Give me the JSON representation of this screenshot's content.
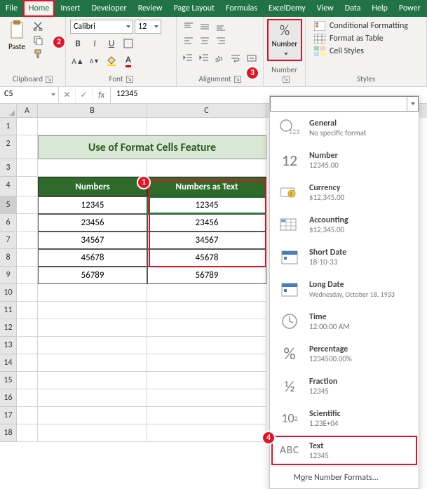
{
  "tabs": {
    "file": "File",
    "home": "Home",
    "insert": "Insert",
    "developer": "Developer",
    "review": "Review",
    "page_layout": "Page Layout",
    "formulas": "Formulas",
    "exceldemy": "ExcelDemy",
    "view": "View",
    "data": "Data",
    "help": "Help",
    "power": "Power"
  },
  "ribbon": {
    "clipboard": {
      "label": "Clipboard",
      "paste": "Paste"
    },
    "font": {
      "label": "Font",
      "name": "Calibri",
      "size": "12"
    },
    "alignment": {
      "label": "Alignment"
    },
    "number": {
      "label": "Number",
      "btn": "Number"
    },
    "styles": {
      "label": "Styles",
      "cond": "Conditional Formatting",
      "table": "Format as Table",
      "cell": "Cell Styles"
    }
  },
  "callouts": {
    "c1": "1",
    "c2": "2",
    "c3": "3",
    "c4": "4"
  },
  "fx": {
    "namebox": "C5",
    "fx": "fx",
    "value": "12345"
  },
  "cols": {
    "A": "A",
    "B": "B",
    "C": "C"
  },
  "rowhdrs": [
    "1",
    "2",
    "3",
    "4",
    "5",
    "6",
    "7",
    "8",
    "9",
    "10",
    "11",
    "12",
    "13",
    "14",
    "15",
    "16",
    "17",
    "18"
  ],
  "sheet": {
    "title": "Use of Format Cells Feature",
    "h1": "Numbers",
    "h2": "Numbers as Text",
    "rows": [
      {
        "b": "12345",
        "c": "12345"
      },
      {
        "b": "23456",
        "c": "23456"
      },
      {
        "b": "34567",
        "c": "34567"
      },
      {
        "b": "45678",
        "c": "45678"
      },
      {
        "b": "56789",
        "c": "56789"
      }
    ]
  },
  "nf": {
    "general": {
      "t": "General",
      "s": "No specific format",
      "i": "123"
    },
    "number": {
      "t": "Number",
      "s": "12345.00",
      "i": "12"
    },
    "currency": {
      "t": "Currency",
      "s": "$12,345.00"
    },
    "accounting": {
      "t": "Accounting",
      "s": "$12,345.00"
    },
    "shortdate": {
      "t": "Short Date",
      "s": "18-10-33"
    },
    "longdate": {
      "t": "Long Date",
      "s": "Wednesday, October 18, 1933"
    },
    "time": {
      "t": "Time",
      "s": "12:00:00 AM"
    },
    "percentage": {
      "t": "Percentage",
      "s": "1234500.00%",
      "i": "%"
    },
    "fraction": {
      "t": "Fraction",
      "s": "12345",
      "i": "½"
    },
    "scientific": {
      "t": "Scientific",
      "s": "1.23E+04",
      "i": "10²"
    },
    "text": {
      "t": "Text",
      "s": "12345",
      "i": "ABC"
    },
    "more_pre": "M",
    "more_u": "o",
    "more_post": "re Number Formats..."
  }
}
